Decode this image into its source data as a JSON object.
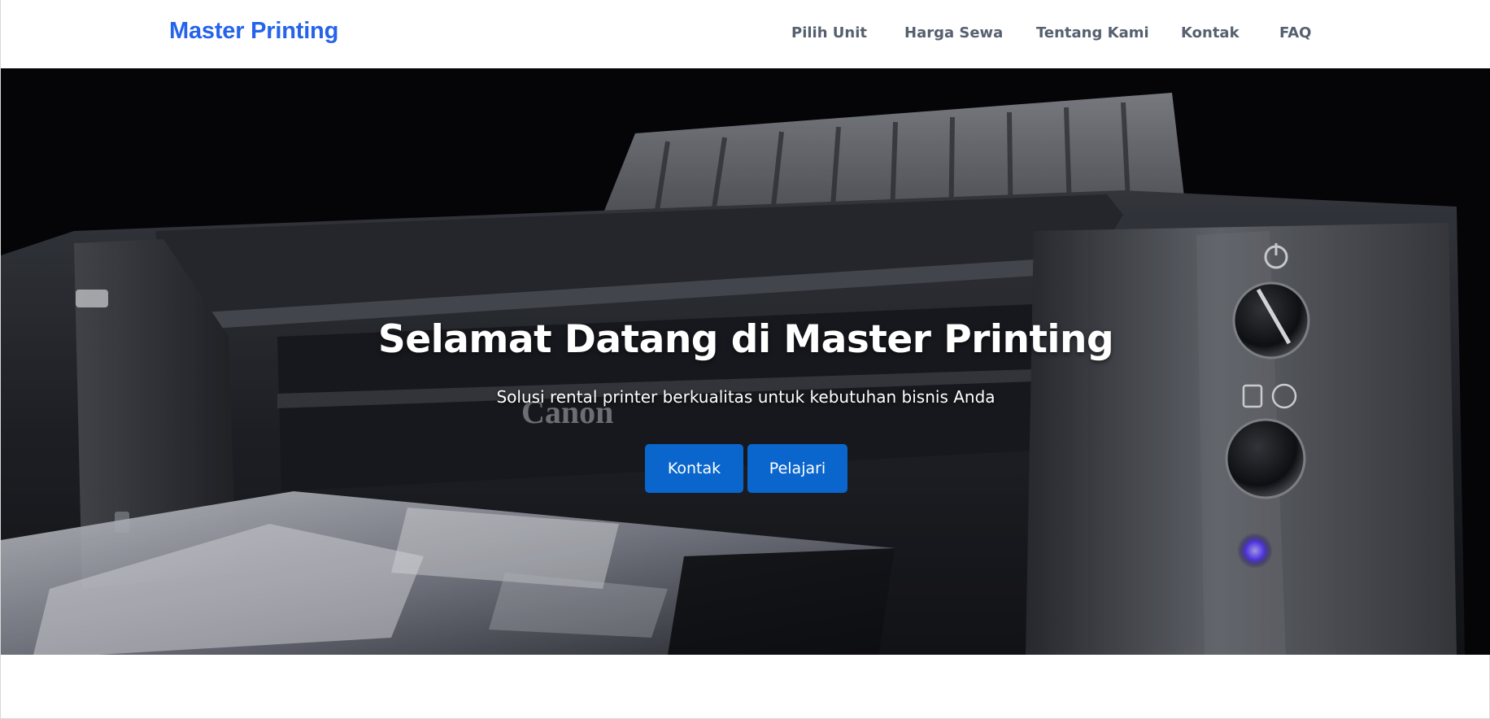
{
  "brand": {
    "name": "Master Printing",
    "color": "#2563eb"
  },
  "nav": {
    "items": [
      {
        "label": "Pilih Unit"
      },
      {
        "label": "Harga Sewa"
      },
      {
        "label": "Tentang Kami"
      },
      {
        "label": "Kontak"
      },
      {
        "label": "FAQ"
      }
    ]
  },
  "hero": {
    "title": "Selamat Datang di Master Printing",
    "subtitle": "Solusi rental printer berkualitas untuk kebutuhan bisnis Anda",
    "background": "printer-photo",
    "buttons": [
      {
        "label": "Kontak"
      },
      {
        "label": "Pelajari"
      }
    ],
    "button_color": "#0a66cc"
  }
}
